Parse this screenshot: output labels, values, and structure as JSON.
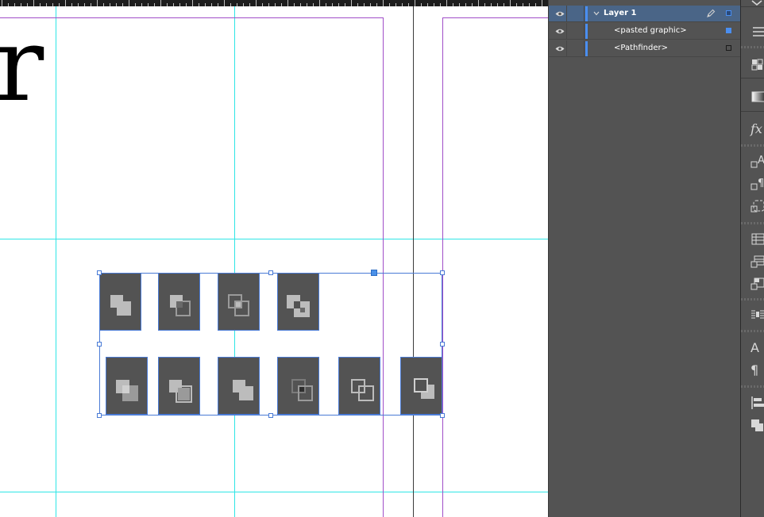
{
  "canvas": {
    "glyph": "r"
  },
  "layers_panel": {
    "rows": [
      {
        "label": "Layer 1",
        "visible": true,
        "expanded": true,
        "selected": true,
        "color": "#4a8ef0"
      },
      {
        "label": "<pasted graphic>",
        "visible": true,
        "selected": false,
        "color": "#4a8ef0"
      },
      {
        "label": "<Pathfinder>",
        "visible": true,
        "selected": false,
        "color": "#1a1a1a"
      }
    ]
  },
  "pathfinder_tiles": [
    {
      "icon": "pathfinder-unite-icon"
    },
    {
      "icon": "pathfinder-minus-back-icon"
    },
    {
      "icon": "pathfinder-intersect-icon"
    },
    {
      "icon": "pathfinder-exclude-overlap-icon"
    },
    {
      "icon": "pathfinder-subtract-icon"
    },
    {
      "icon": "pathfinder-front-icon"
    },
    {
      "icon": "pathfinder-overlap-icon"
    },
    {
      "icon": "pathfinder-divide-icon"
    },
    {
      "icon": "pathfinder-outline-icon"
    },
    {
      "icon": "pathfinder-back-icon"
    }
  ],
  "dock": {
    "fx_label": "fx",
    "char_label": "A",
    "pilcrow": "¶",
    "icons": [
      "collapse-icon",
      "swatches-icon",
      "gradient-icon",
      "effects-icon",
      "character-styles-icon",
      "paragraph-styles-icon",
      "object-styles-icon",
      "table-icon",
      "table-styles-icon",
      "cell-styles-icon",
      "text-wrap-icon",
      "character-icon",
      "paragraph-icon",
      "align-icon",
      "pathfinder-icon"
    ]
  },
  "colors": {
    "guide": "#2ee6e6",
    "margin": "#a04ec8",
    "selection": "#4a7bd6",
    "panel_bg": "#535353",
    "selected_row": "#4a6587"
  }
}
